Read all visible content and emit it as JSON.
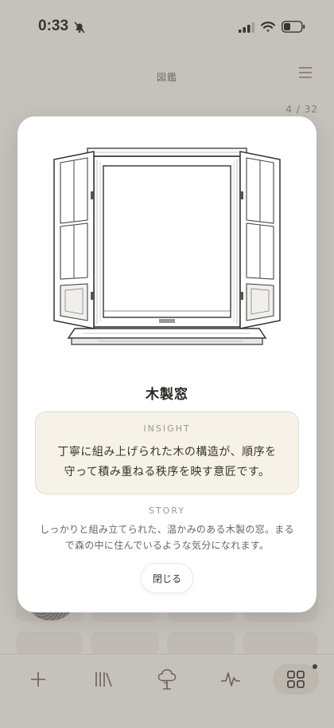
{
  "status": {
    "time": "0:33"
  },
  "header": {
    "title": "図鑑"
  },
  "counter": "4 / 32",
  "modal": {
    "title": "木製窓",
    "insight_label": "INSIGHT",
    "insight_text": "丁寧に組み上げられた木の構造が、順序を守って積み重ねる秩序を映す意匠です。",
    "story_label": "STORY",
    "story_text": "しっかりと組み立てられた、温かみのある木製の窓。まるで森の中に住んでいるような気分になれます。",
    "close_label": "閉じる"
  },
  "tabs": [
    {
      "icon": "plus-icon"
    },
    {
      "icon": "library-icon"
    },
    {
      "icon": "tree-icon"
    },
    {
      "icon": "pulse-icon"
    },
    {
      "icon": "grid-icon",
      "active": true
    }
  ]
}
